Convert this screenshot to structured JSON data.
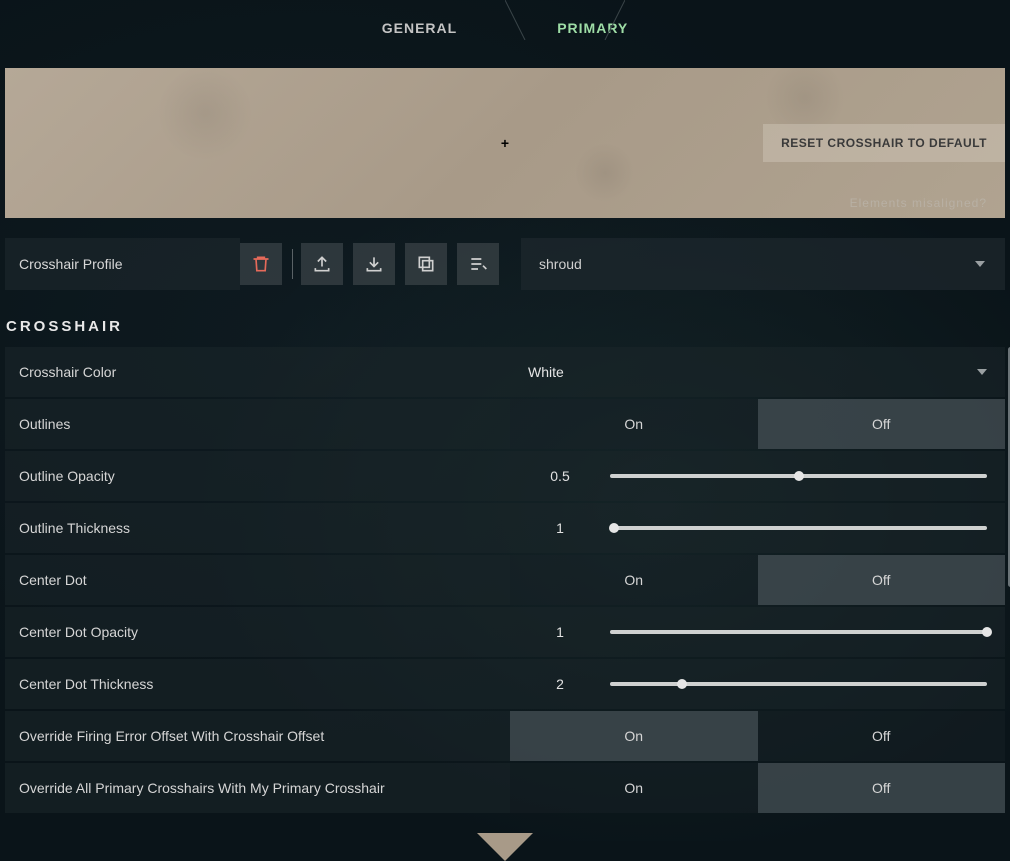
{
  "tabs": {
    "general": "GENERAL",
    "primary": "PRIMARY"
  },
  "preview": {
    "reset_label": "RESET CROSSHAIR TO DEFAULT",
    "misaligned_text": "Elements misaligned?"
  },
  "profile": {
    "label": "Crosshair Profile",
    "selected": "shroud"
  },
  "section_title": "CROSSHAIR",
  "toggle_labels": {
    "on": "On",
    "off": "Off"
  },
  "settings": {
    "color": {
      "label": "Crosshair Color",
      "value": "White"
    },
    "outlines": {
      "label": "Outlines",
      "value": "Off"
    },
    "outline_opacity": {
      "label": "Outline Opacity",
      "value": "0.5",
      "percent": 50
    },
    "outline_thickness": {
      "label": "Outline Thickness",
      "value": "1",
      "percent": 1
    },
    "center_dot": {
      "label": "Center Dot",
      "value": "Off"
    },
    "center_dot_opacity": {
      "label": "Center Dot Opacity",
      "value": "1",
      "percent": 100
    },
    "center_dot_thickness": {
      "label": "Center Dot Thickness",
      "value": "2",
      "percent": 19
    },
    "override_firing": {
      "label": "Override Firing Error Offset With Crosshair Offset",
      "value": "On"
    },
    "override_all": {
      "label": "Override All Primary Crosshairs With My Primary Crosshair",
      "value": "Off"
    }
  }
}
